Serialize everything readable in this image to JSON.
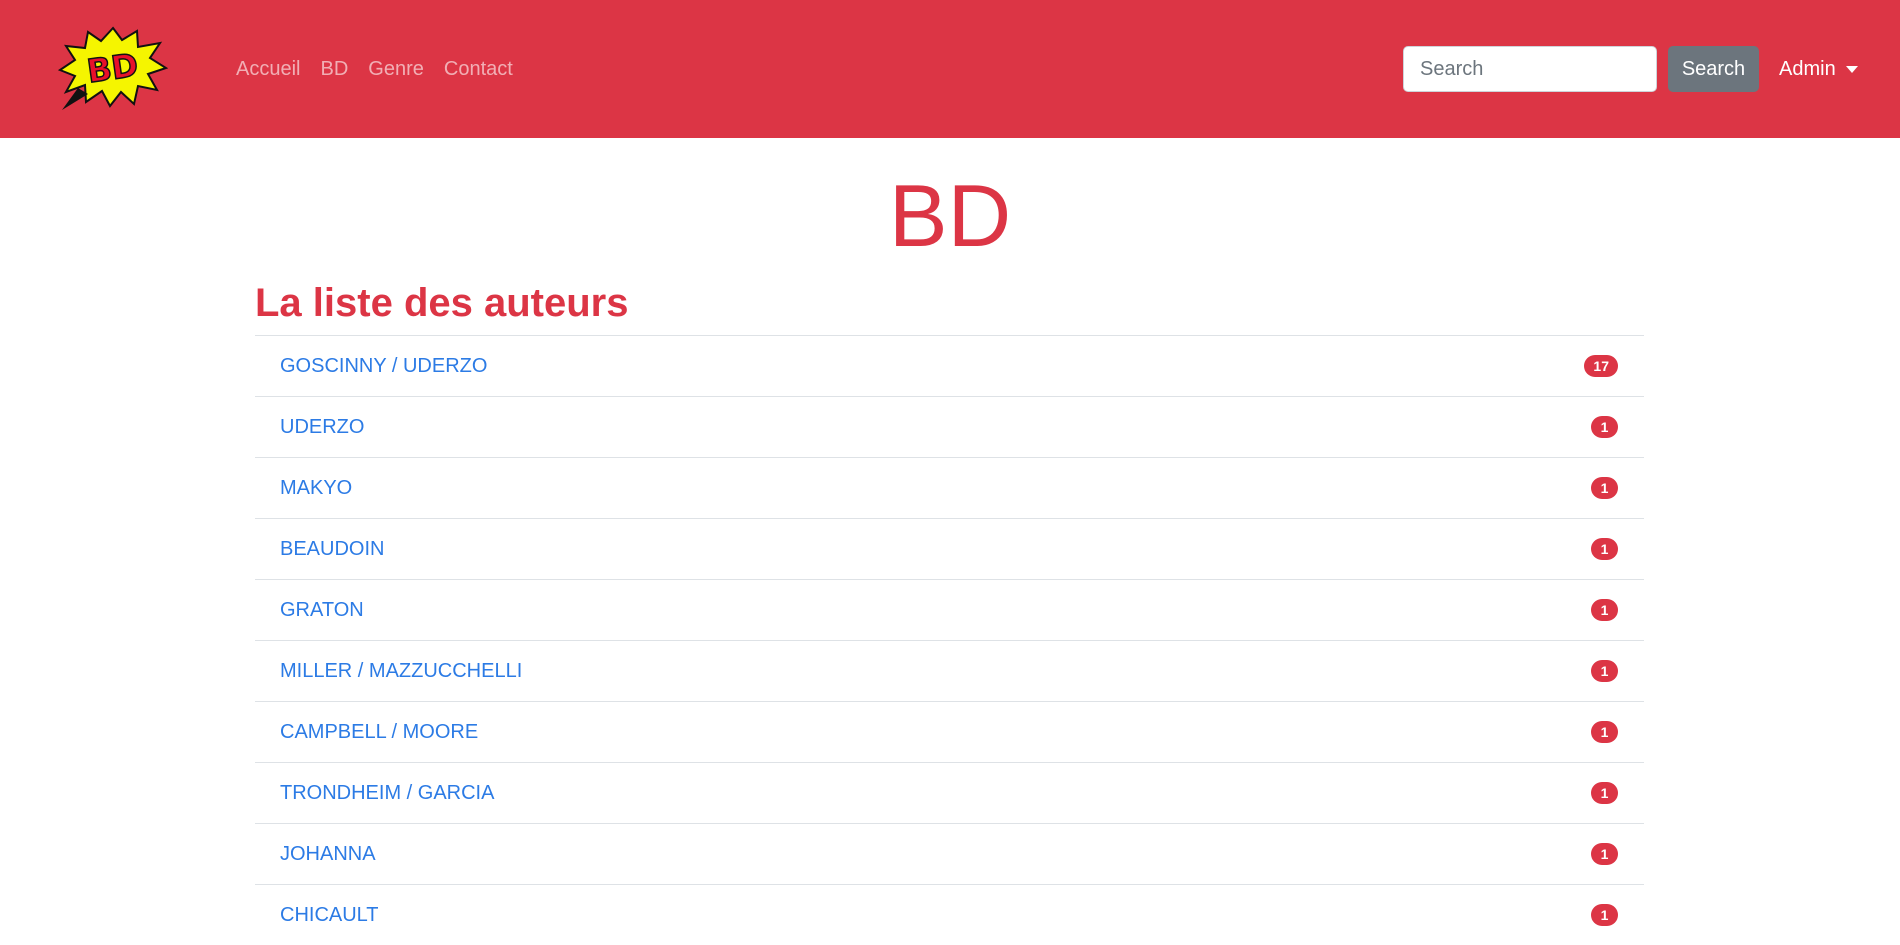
{
  "brand": {
    "logo_text": "BD",
    "logo_icon": "bd-comic-burst-icon"
  },
  "nav": {
    "links": [
      "Accueil",
      "BD",
      "Genre",
      "Contact"
    ]
  },
  "search": {
    "placeholder": "Search",
    "button_label": "Search"
  },
  "admin": {
    "label": "Admin",
    "icon": "chevron-down-icon"
  },
  "page": {
    "title": "BD",
    "section_heading": "La liste des auteurs"
  },
  "authors": [
    {
      "name": "GOSCINNY / UDERZO",
      "count": "17"
    },
    {
      "name": "UDERZO",
      "count": "1"
    },
    {
      "name": "MAKYO",
      "count": "1"
    },
    {
      "name": "BEAUDOIN",
      "count": "1"
    },
    {
      "name": "GRATON",
      "count": "1"
    },
    {
      "name": "MILLER / MAZZUCCHELLI",
      "count": "1"
    },
    {
      "name": "CAMPBELL / MOORE",
      "count": "1"
    },
    {
      "name": "TRONDHEIM / GARCIA",
      "count": "1"
    },
    {
      "name": "JOHANNA",
      "count": "1"
    },
    {
      "name": "CHICAULT",
      "count": "1"
    }
  ],
  "colors": {
    "brand_red": "#dc3545",
    "link_blue": "#2c7be5",
    "button_gray": "#6c757d",
    "logo_yellow": "#f5f500"
  }
}
